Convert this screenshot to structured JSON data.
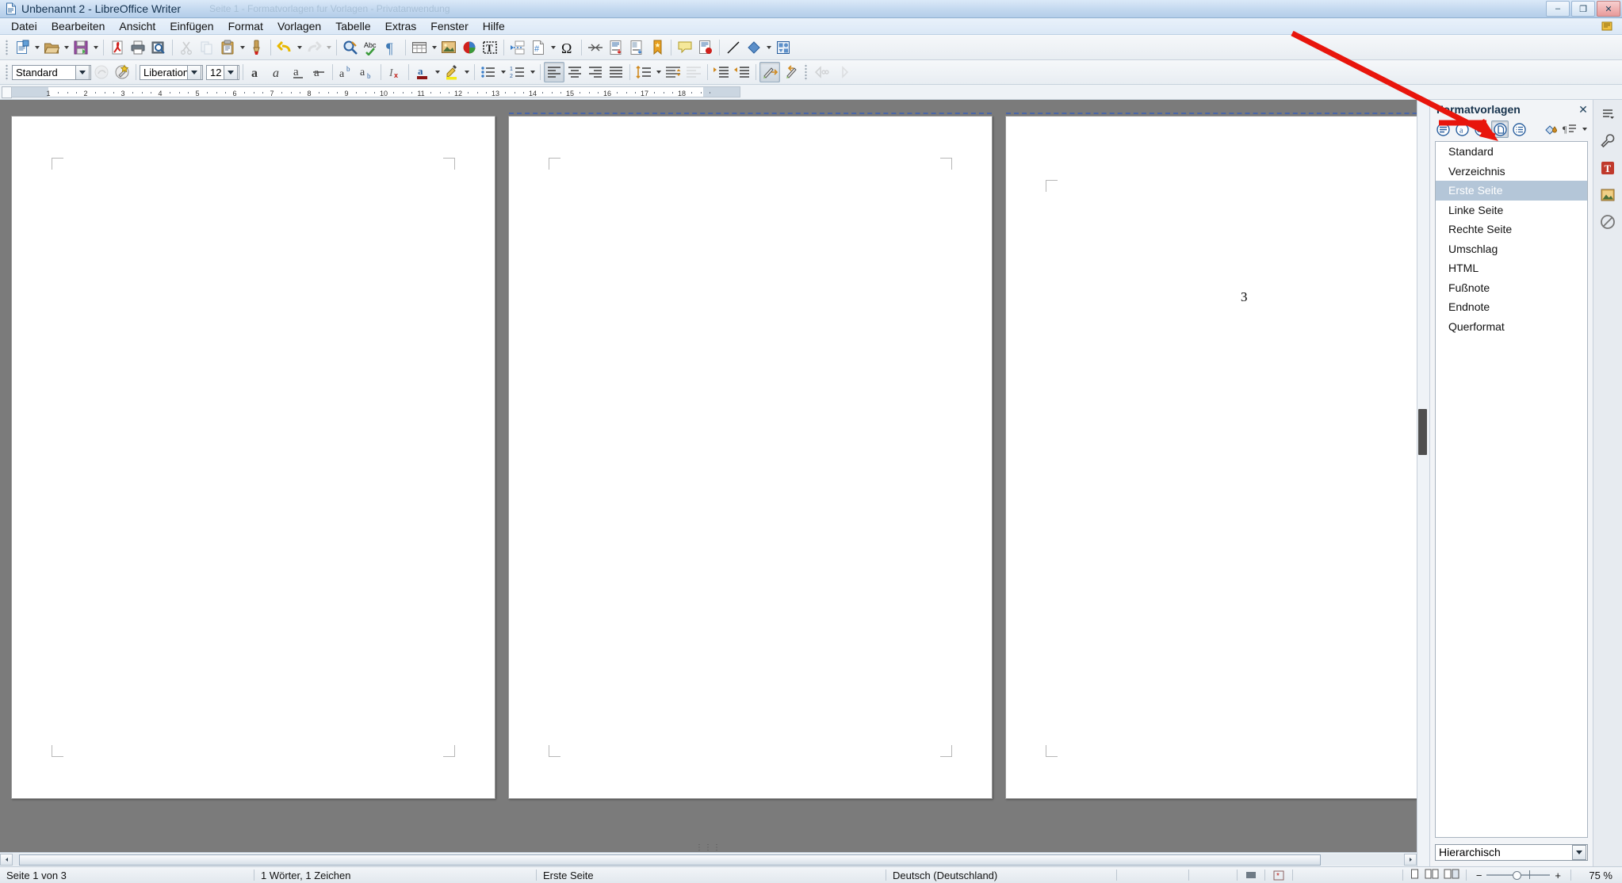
{
  "window": {
    "title": "Unbenannt 2 - LibreOffice Writer",
    "ghost_text": "Seite 1 - Formatvorlagen fur Vorlagen - Privatanwendung",
    "app_icon": "writer-document-icon",
    "minimize_label": "–",
    "maximize_label": "❐",
    "close_label": "✕"
  },
  "menubar": {
    "items": [
      {
        "label": "Datei",
        "accel": "D"
      },
      {
        "label": "Bearbeiten",
        "accel": "B"
      },
      {
        "label": "Ansicht",
        "accel": "A"
      },
      {
        "label": "Einfügen",
        "accel": "E"
      },
      {
        "label": "Format",
        "accel": "F"
      },
      {
        "label": "Vorlagen",
        "accel": "V"
      },
      {
        "label": "Tabelle",
        "accel": "T"
      },
      {
        "label": "Extras",
        "accel": "x"
      },
      {
        "label": "Fenster",
        "accel": "s"
      },
      {
        "label": "Hilfe",
        "accel": "H"
      }
    ]
  },
  "standard_toolbar": {
    "buttons": [
      {
        "name": "new-document-icon",
        "label": "Neu",
        "dropdown": true,
        "enabled": true
      },
      {
        "name": "open-document-icon",
        "label": "Öffnen",
        "dropdown": true,
        "enabled": true
      },
      {
        "name": "save-document-icon",
        "label": "Speichern",
        "dropdown": true,
        "enabled": true
      },
      {
        "name": "separator"
      },
      {
        "name": "export-pdf-icon",
        "label": "Als PDF exportieren",
        "enabled": true
      },
      {
        "name": "print-icon",
        "label": "Drucken",
        "enabled": true
      },
      {
        "name": "print-preview-icon",
        "label": "Druckvorschau",
        "enabled": true
      },
      {
        "name": "separator"
      },
      {
        "name": "cut-icon",
        "label": "Ausschneiden",
        "enabled": false
      },
      {
        "name": "copy-icon",
        "label": "Kopieren",
        "enabled": false
      },
      {
        "name": "paste-icon",
        "label": "Einfügen",
        "dropdown": true,
        "enabled": true
      },
      {
        "name": "clone-formatting-icon",
        "label": "Formatierung übertragen",
        "enabled": true
      },
      {
        "name": "separator"
      },
      {
        "name": "undo-icon",
        "label": "Rückgängig",
        "dropdown": true,
        "enabled": true
      },
      {
        "name": "redo-icon",
        "label": "Wiederholen",
        "dropdown": true,
        "enabled": false
      },
      {
        "name": "separator"
      },
      {
        "name": "find-replace-icon",
        "label": "Suchen und Ersetzen",
        "enabled": true
      },
      {
        "name": "spelling-icon",
        "label": "Rechtschreibung",
        "enabled": true
      },
      {
        "name": "formatting-marks-icon",
        "label": "Formatierungszeichen",
        "enabled": true
      },
      {
        "name": "separator"
      },
      {
        "name": "insert-table-icon",
        "label": "Tabelle einfügen",
        "dropdown": true,
        "enabled": true
      },
      {
        "name": "insert-image-icon",
        "label": "Bild einfügen",
        "enabled": true
      },
      {
        "name": "insert-chart-icon",
        "label": "Diagramm einfügen",
        "enabled": true
      },
      {
        "name": "insert-text-box-icon",
        "label": "Textrahmen einfügen",
        "enabled": true
      },
      {
        "name": "separator"
      },
      {
        "name": "page-break-icon",
        "label": "Seitenumbruch einfügen",
        "enabled": true
      },
      {
        "name": "insert-field-icon",
        "label": "Feldbefehl einfügen",
        "dropdown": true,
        "enabled": true
      },
      {
        "name": "special-character-icon",
        "label": "Sonderzeichen",
        "enabled": true
      },
      {
        "name": "separator"
      },
      {
        "name": "insert-section-icon",
        "label": "Bereich einfügen",
        "enabled": true
      },
      {
        "name": "insert-footnote-icon",
        "label": "Fußnote einfügen",
        "enabled": true
      },
      {
        "name": "insert-endnote-icon",
        "label": "Endnote einfügen",
        "enabled": true
      },
      {
        "name": "insert-bookmark-icon",
        "label": "Lesezeichen einfügen",
        "enabled": true
      },
      {
        "name": "separator"
      },
      {
        "name": "insert-comment-icon",
        "label": "Kommentar einfügen",
        "enabled": true
      },
      {
        "name": "track-changes-icon",
        "label": "Änderungen aufzeichnen",
        "enabled": true
      },
      {
        "name": "separator"
      },
      {
        "name": "insert-line-icon",
        "label": "Linie einfügen",
        "enabled": true
      },
      {
        "name": "basic-shapes-icon",
        "label": "Standardformen",
        "dropdown": true,
        "enabled": true
      },
      {
        "name": "show-draw-functions-icon",
        "label": "Zeichnungsfunktionen",
        "enabled": true
      }
    ]
  },
  "formatting_toolbar": {
    "paragraph_style": {
      "value": "Standard",
      "name": "paragraph-style-combo"
    },
    "font_name": {
      "value": "Liberation Serif",
      "name": "font-name-combo"
    },
    "font_size": {
      "value": "12",
      "name": "font-size-combo"
    },
    "buttons": [
      {
        "name": "update-style-icon",
        "label": "Vorlage aktualisieren",
        "enabled": false
      },
      {
        "name": "new-style-icon",
        "label": "Neue Vorlage aus Auswahl",
        "enabled": true
      },
      {
        "name": "separator"
      },
      {
        "name": "bold-icon",
        "label": "Fett",
        "enabled": true
      },
      {
        "name": "italic-icon",
        "label": "Kursiv",
        "enabled": true
      },
      {
        "name": "underline-icon",
        "label": "Unterstrichen",
        "enabled": true
      },
      {
        "name": "strikethrough-icon",
        "label": "Durchgestrichen",
        "enabled": true
      },
      {
        "name": "superscript-icon",
        "label": "Hochgestellt",
        "enabled": true
      },
      {
        "name": "subscript-icon",
        "label": "Tiefgestellt",
        "enabled": true
      },
      {
        "name": "separator"
      },
      {
        "name": "clear-formatting-icon",
        "label": "Direkte Formatierung löschen",
        "enabled": true
      },
      {
        "name": "separator"
      },
      {
        "name": "font-color-icon",
        "label": "Zeichenfarbe",
        "dropdown": true,
        "enabled": true
      },
      {
        "name": "highlighting-icon",
        "label": "Zeichenhintergrund",
        "dropdown": true,
        "enabled": true
      },
      {
        "name": "separator"
      },
      {
        "name": "unordered-list-icon",
        "label": "Ungeordnete Liste",
        "dropdown": true,
        "enabled": true
      },
      {
        "name": "ordered-list-icon",
        "label": "Geordnete Liste",
        "dropdown": true,
        "enabled": true
      },
      {
        "name": "separator"
      },
      {
        "name": "align-left-icon",
        "label": "Linksbündig",
        "enabled": true,
        "active": true
      },
      {
        "name": "align-center-icon",
        "label": "Zentriert",
        "enabled": true
      },
      {
        "name": "align-right-icon",
        "label": "Rechtsbündig",
        "enabled": true
      },
      {
        "name": "align-justified-icon",
        "label": "Blocksatz",
        "enabled": true
      },
      {
        "name": "separator"
      },
      {
        "name": "line-spacing-icon",
        "label": "Zeilenabstand",
        "dropdown": true,
        "enabled": true
      },
      {
        "name": "increase-paragraph-spacing-icon",
        "label": "Absatzabstand erhöhen",
        "enabled": true
      },
      {
        "name": "decrease-paragraph-spacing-icon",
        "label": "Absatzabstand verringern",
        "enabled": false
      },
      {
        "name": "separator"
      },
      {
        "name": "increase-indent-icon",
        "label": "Einzug vergrößern",
        "enabled": true
      },
      {
        "name": "decrease-indent-icon",
        "label": "Einzug verkleinern",
        "enabled": true
      },
      {
        "name": "separator"
      },
      {
        "name": "formatting-pen-forward-icon",
        "label": "Formatierung übernehmen",
        "enabled": true,
        "active": true
      },
      {
        "name": "formatting-pen-back-icon",
        "label": "Formatierung zurück",
        "enabled": true
      },
      {
        "name": "separator"
      },
      {
        "name": "nav-previous-icon",
        "label": "Vorheriges",
        "enabled": false
      },
      {
        "name": "nav-next-icon",
        "label": "Nächstes",
        "enabled": false
      }
    ]
  },
  "ruler": {
    "unit_icon": "ruler-corner-icon",
    "ticks": [
      "1",
      "2",
      "3",
      "4",
      "5",
      "6",
      "7",
      "8",
      "9",
      "10",
      "11",
      "12",
      "13",
      "14",
      "15",
      "16",
      "17",
      "18"
    ]
  },
  "document": {
    "pages": [
      {
        "name": "page-1",
        "number": 1,
        "content": ""
      },
      {
        "name": "page-2",
        "number": 2,
        "content": ""
      },
      {
        "name": "page-3",
        "number": 3,
        "content": "3"
      }
    ],
    "caret_char": "3",
    "split_grip": "⋮⋮⋮"
  },
  "sidebar": {
    "deck_title": "Formatvorlagen",
    "close_label": "✕",
    "category_buttons": [
      {
        "name": "paragraph-styles-icon",
        "label": "Absatzvorlagen",
        "active": false
      },
      {
        "name": "character-styles-icon",
        "label": "Zeichenvorlagen",
        "active": false
      },
      {
        "name": "frame-styles-icon",
        "label": "Rahmenvorlagen",
        "active": false
      },
      {
        "name": "page-styles-icon",
        "label": "Seitenvorlagen",
        "active": true
      },
      {
        "name": "list-styles-icon",
        "label": "Listenvorlagen",
        "active": false
      }
    ],
    "action_buttons": [
      {
        "name": "fill-format-mode-icon",
        "label": "Gießkannenmodus"
      },
      {
        "name": "new-style-from-selection-icon",
        "label": "Neue Vorlage aus Auswahl",
        "dropdown": true
      }
    ],
    "styles": [
      {
        "label": "Standard",
        "selected": false
      },
      {
        "label": "Verzeichnis",
        "selected": false
      },
      {
        "label": "Erste Seite",
        "selected": true
      },
      {
        "label": "Linke Seite",
        "selected": false
      },
      {
        "label": "Rechte Seite",
        "selected": false
      },
      {
        "label": "Umschlag",
        "selected": false
      },
      {
        "label": "HTML",
        "selected": false
      },
      {
        "label": "Fußnote",
        "selected": false
      },
      {
        "label": "Endnote",
        "selected": false
      },
      {
        "label": "Querformat",
        "selected": false
      }
    ],
    "filter": {
      "value": "Hierarchisch",
      "name": "style-filter-combo"
    }
  },
  "tabrail": {
    "buttons": [
      {
        "name": "sidebar-settings-icon",
        "label": "Sidebar-Einstellungen"
      },
      {
        "name": "properties-deck-icon",
        "label": "Eigenschaften"
      },
      {
        "name": "styles-deck-icon",
        "label": "Formatvorlagen"
      },
      {
        "name": "gallery-deck-icon",
        "label": "Gallery"
      },
      {
        "name": "navigator-deck-icon",
        "label": "Navigator"
      }
    ]
  },
  "statusbar": {
    "page_info": "Seite 1 von 3",
    "word_count": "1 Wörter, 1 Zeichen",
    "page_style": "Erste Seite",
    "language": "Deutsch (Deutschland)",
    "insert_mode": "",
    "selection_mode": "",
    "save_status_icon": "document-modified-icon",
    "digital_signature_icon": "signature-icon",
    "view_buttons": [
      {
        "name": "single-page-view-icon",
        "label": "Einzelne Seite"
      },
      {
        "name": "multi-page-view-icon",
        "label": "Mehrere Seiten"
      },
      {
        "name": "book-view-icon",
        "label": "Buchansicht"
      }
    ],
    "zoom_minus": "−",
    "zoom_plus": "+",
    "zoom_value": "75 %"
  },
  "annotation": {
    "arrow_color": "#e8150c",
    "description": "red-arrow-pointing-to-page-styles-button"
  },
  "colors": {
    "selection": "#b4c6d8",
    "page_background": "#7b7b7b",
    "page_break_line": "#4a66a8",
    "accent": "#2a6099"
  }
}
